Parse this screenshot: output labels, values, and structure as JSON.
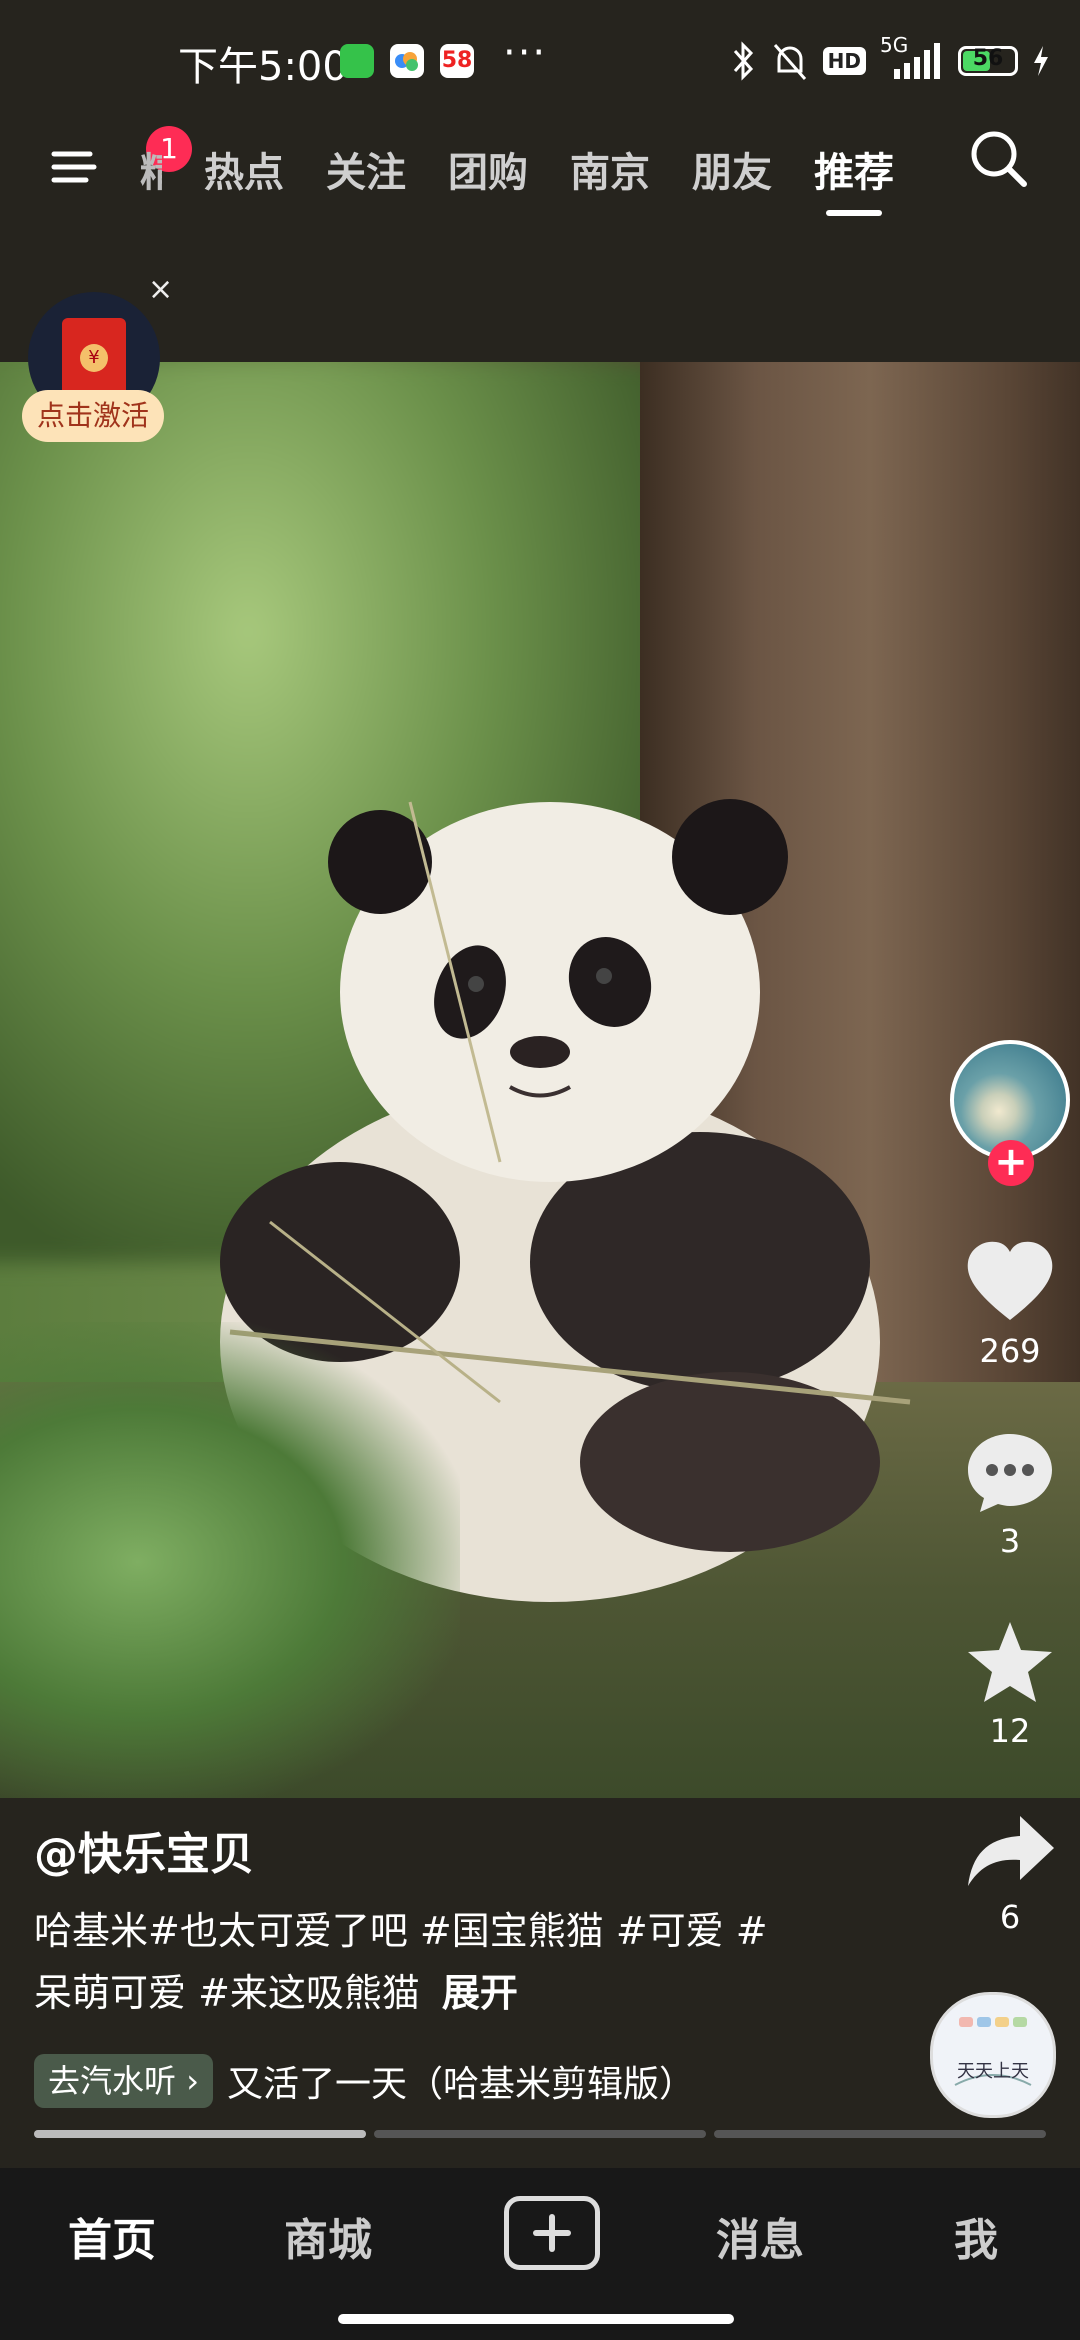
{
  "status_bar": {
    "time": "下午5:00",
    "app_icons": [
      "wechat-like-icon",
      "cloud-icon",
      "58-app-icon"
    ],
    "app58_label": "58",
    "more": "···",
    "network": "5G",
    "hd": "HD",
    "battery": "56",
    "battery_level": 0.56
  },
  "top_nav": {
    "menu_badge": "1",
    "tabs": [
      {
        "label": "精选",
        "active": false
      },
      {
        "label": "热点",
        "active": false
      },
      {
        "label": "关注",
        "active": false
      },
      {
        "label": "团购",
        "active": false
      },
      {
        "label": "南京",
        "active": false
      },
      {
        "label": "朋友",
        "active": false
      },
      {
        "label": "推荐",
        "active": true
      }
    ]
  },
  "red_packet": {
    "seal": "¥",
    "close": "×",
    "label": "点击激活"
  },
  "rail": {
    "follow": "+",
    "likes": "269",
    "comments": "3",
    "favorites": "12",
    "shares": "6"
  },
  "caption": {
    "author": "@快乐宝贝",
    "line1": "哈基米#也太可爱了吧 #国宝熊猫 #可爱 #",
    "line2": "呆萌可爱 #来这吸熊猫",
    "expand": "展开",
    "music_chip": "去汽水听",
    "music_chip_arrow": "›",
    "music_title": "又活了一天（哈基米剪辑版）",
    "progress": [
      1.0,
      0.0,
      0.0
    ],
    "disc_text": "天天上天"
  },
  "bottom_nav": {
    "home": "首页",
    "mall": "商城",
    "messages": "消息",
    "me": "我"
  },
  "colors": {
    "accent": "#fe2c55",
    "background": "#26241e"
  }
}
